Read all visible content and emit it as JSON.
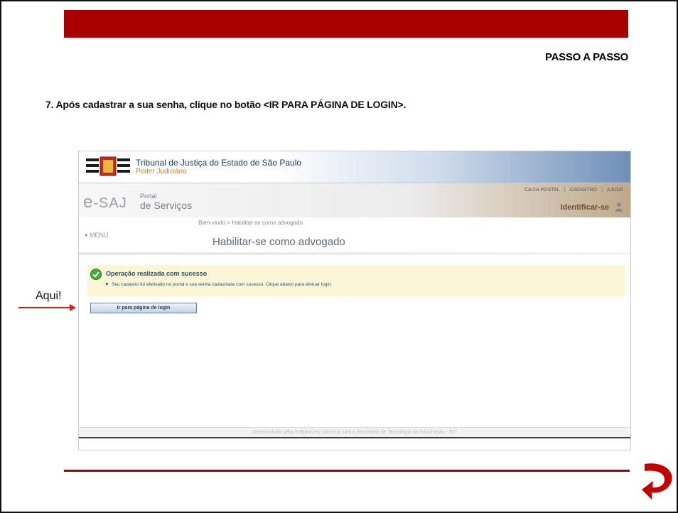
{
  "slide": {
    "header_label": "PASSO A PASSO",
    "instruction": "7. Após cadastrar a sua senha, clique no botão <IR PARA PÁGINA DE LOGIN>.",
    "pointer_label": "Aqui!",
    "accent_color": "#a80000"
  },
  "screenshot": {
    "court_title": "Tribunal de Justiça do Estado de São Paulo",
    "court_subtitle": "Poder Judiciário",
    "brand_e": "e",
    "brand_saj": "-SAJ",
    "brand_portal": "Portal",
    "brand_servicos": "de Serviços",
    "toplinks": [
      "CAIXA POSTAL",
      "CADASTRO",
      "AJUDA"
    ],
    "identify_label": "Identificar-se",
    "breadcrumb": "Bem-vindo > Habilitar-se como advogado",
    "menu_label": "MENU",
    "page_title": "Habilitar-se como advogado",
    "message_title": "Operação realizada com sucesso",
    "message_detail": "Seu cadastro foi efetivado no portal e sua senha cadastrada com sucesso. Clique abaixo para efetuar login.",
    "login_button": "Ir para página de login",
    "footer_text": "Desenvolvido pela Softplan em parceria com a Secretaria de Tecnologia da Informação - STI"
  },
  "icons": {
    "court_logo": "court-logo-icon",
    "user": "user-icon",
    "success": "check-circle-icon",
    "next": "next-arrow-icon"
  }
}
